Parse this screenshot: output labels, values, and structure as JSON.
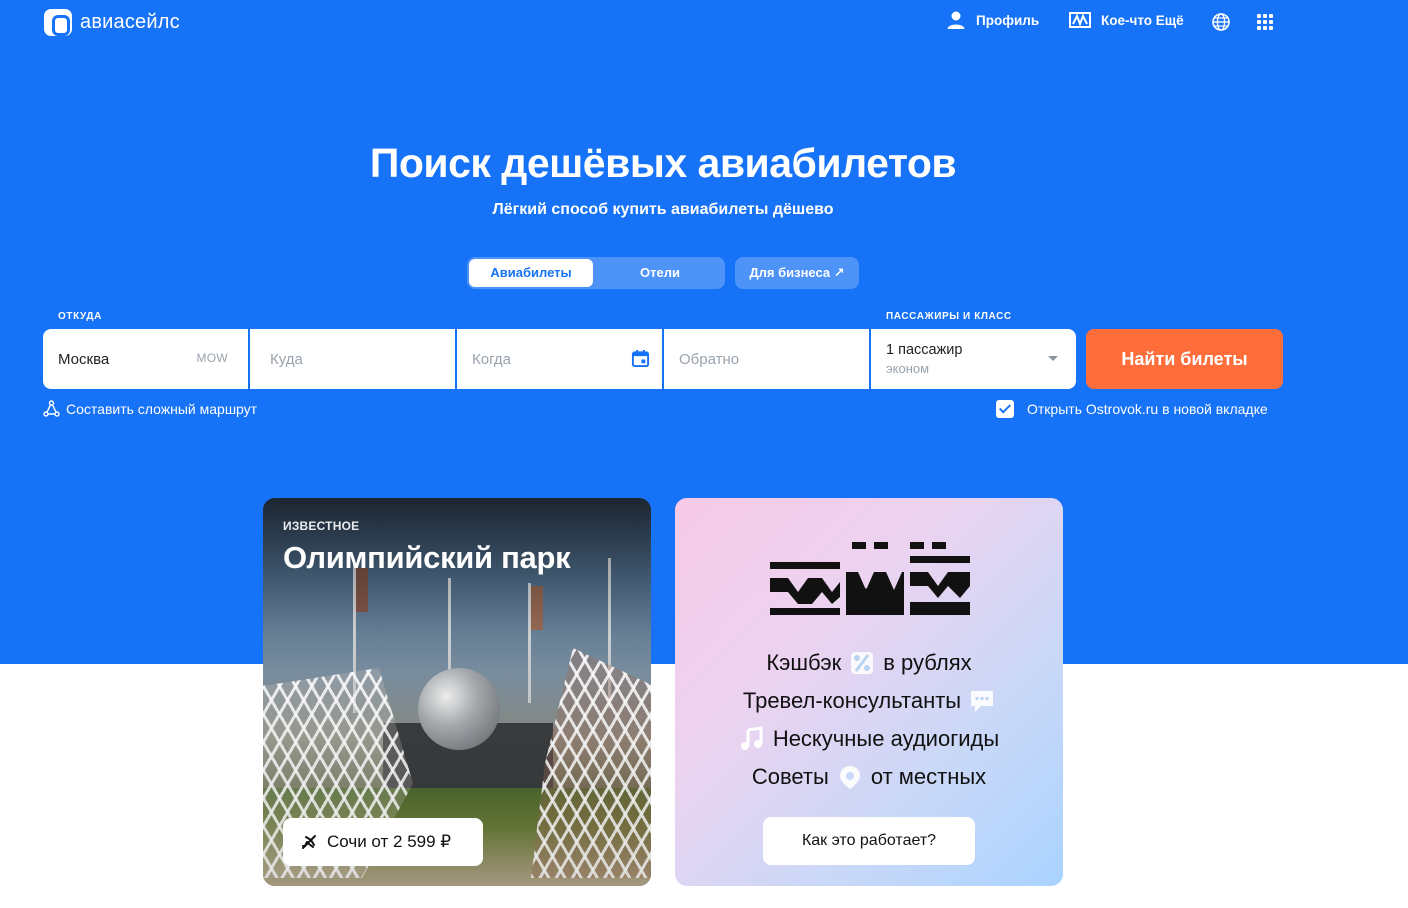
{
  "header": {
    "logo_text": "авиасейлс",
    "profile_label": "Профиль",
    "more_label": "Кое-что Ещё"
  },
  "hero": {
    "title": "Поиск дешёвых авиабилетов",
    "subtitle": "Лёгкий способ купить авиабилеты дёшево"
  },
  "tabs": {
    "items": [
      {
        "label": "Авиабилеты",
        "active": true
      },
      {
        "label": "Отели",
        "active": false
      }
    ],
    "business_label": "Для бизнеса ↗"
  },
  "search": {
    "from_label": "ОТКУДА",
    "from_value": "Москва",
    "from_code": "MOW",
    "to_placeholder": "Куда",
    "when_placeholder": "Когда",
    "return_placeholder": "Обратно",
    "passengers_label": "ПАССАЖИРЫ И КЛАСС",
    "passengers_value": "1 пассажир",
    "class_value": "эконом",
    "submit_label": "Найти билеты",
    "complex_route_label": "Составить сложный маршрут",
    "ostrovok_label": "Открыть Ostrovok.ru в новой вкладке",
    "ostrovok_checked": true
  },
  "cards": {
    "park": {
      "tag": "ИЗВЕСТНОЕ",
      "title": "Олимпийский парк",
      "price_label": "Сочи от 2 599 ₽"
    },
    "promo": {
      "lines": [
        "Кэшбэк",
        "в рублях",
        "Тревел-консультанты",
        "Нескучные аудиогиды",
        "Советы",
        "от местных"
      ],
      "button_label": "Как это работает?"
    }
  },
  "colors": {
    "brand_blue": "#1672F6",
    "accent_orange": "#FF6D3A"
  }
}
